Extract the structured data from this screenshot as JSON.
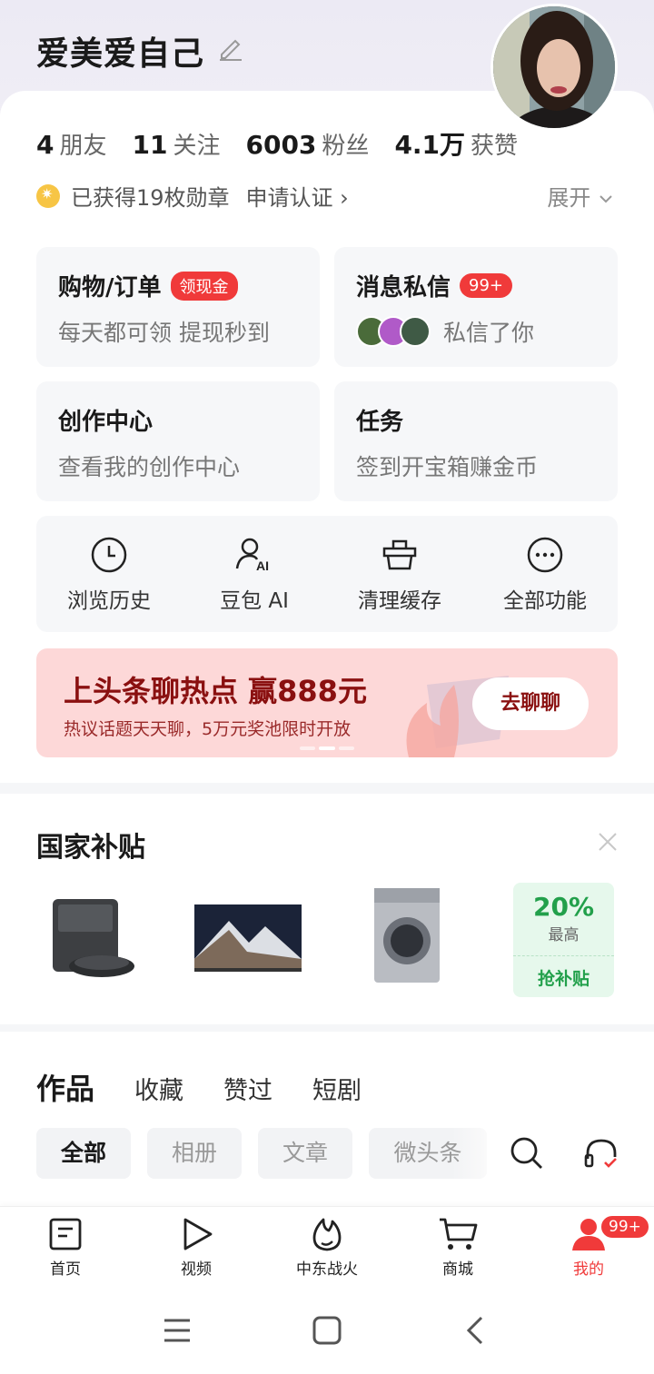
{
  "profile": {
    "username": "爱美爱自己",
    "stats": [
      {
        "num": "4",
        "label": "朋友"
      },
      {
        "num": "11",
        "label": "关注"
      },
      {
        "num": "6003",
        "label": "粉丝"
      },
      {
        "num": "4.1万",
        "label": "获赞"
      }
    ],
    "badges_text": "已获得19枚勋章",
    "certify_text": "申请认证 ›",
    "expand_text": "展开"
  },
  "cards": {
    "shopping": {
      "title": "购物/订单",
      "tag": "领现金",
      "sub": "每天都可领 提现秒到"
    },
    "messages": {
      "title": "消息私信",
      "tag": "99+",
      "sub": "私信了你"
    },
    "creator": {
      "title": "创作中心",
      "sub": "查看我的创作中心"
    },
    "tasks": {
      "title": "任务",
      "sub": "签到开宝箱赚金币"
    }
  },
  "quick_actions": [
    {
      "label": "浏览历史",
      "icon": "clock-icon"
    },
    {
      "label": "豆包 AI",
      "icon": "ai-person-icon"
    },
    {
      "label": "清理缓存",
      "icon": "basket-icon"
    },
    {
      "label": "全部功能",
      "icon": "more-icon"
    }
  ],
  "banner": {
    "title": "上头条聊热点 赢888元",
    "subtitle": "热议话题天天聊，5万元奖池限时开放",
    "button": "去聊聊"
  },
  "subsidy": {
    "title": "国家补贴",
    "promo_percent": "20%",
    "promo_label": "最高",
    "promo_button": "抢补贴"
  },
  "works": {
    "tabs": [
      "作品",
      "收藏",
      "赞过",
      "短剧"
    ],
    "chips": [
      "全部",
      "相册",
      "文章",
      "微头条"
    ]
  },
  "bottom_nav": [
    {
      "label": "首页",
      "icon": "home-doc-icon"
    },
    {
      "label": "视频",
      "icon": "play-icon"
    },
    {
      "label": "中东战火",
      "icon": "flame-icon"
    },
    {
      "label": "商城",
      "icon": "cart-icon"
    },
    {
      "label": "我的",
      "icon": "person-icon",
      "badge": "99+"
    }
  ],
  "colors": {
    "accent": "#f03a3a",
    "banner_bg": "#fdd8d8",
    "promo_green": "#22a04b"
  }
}
